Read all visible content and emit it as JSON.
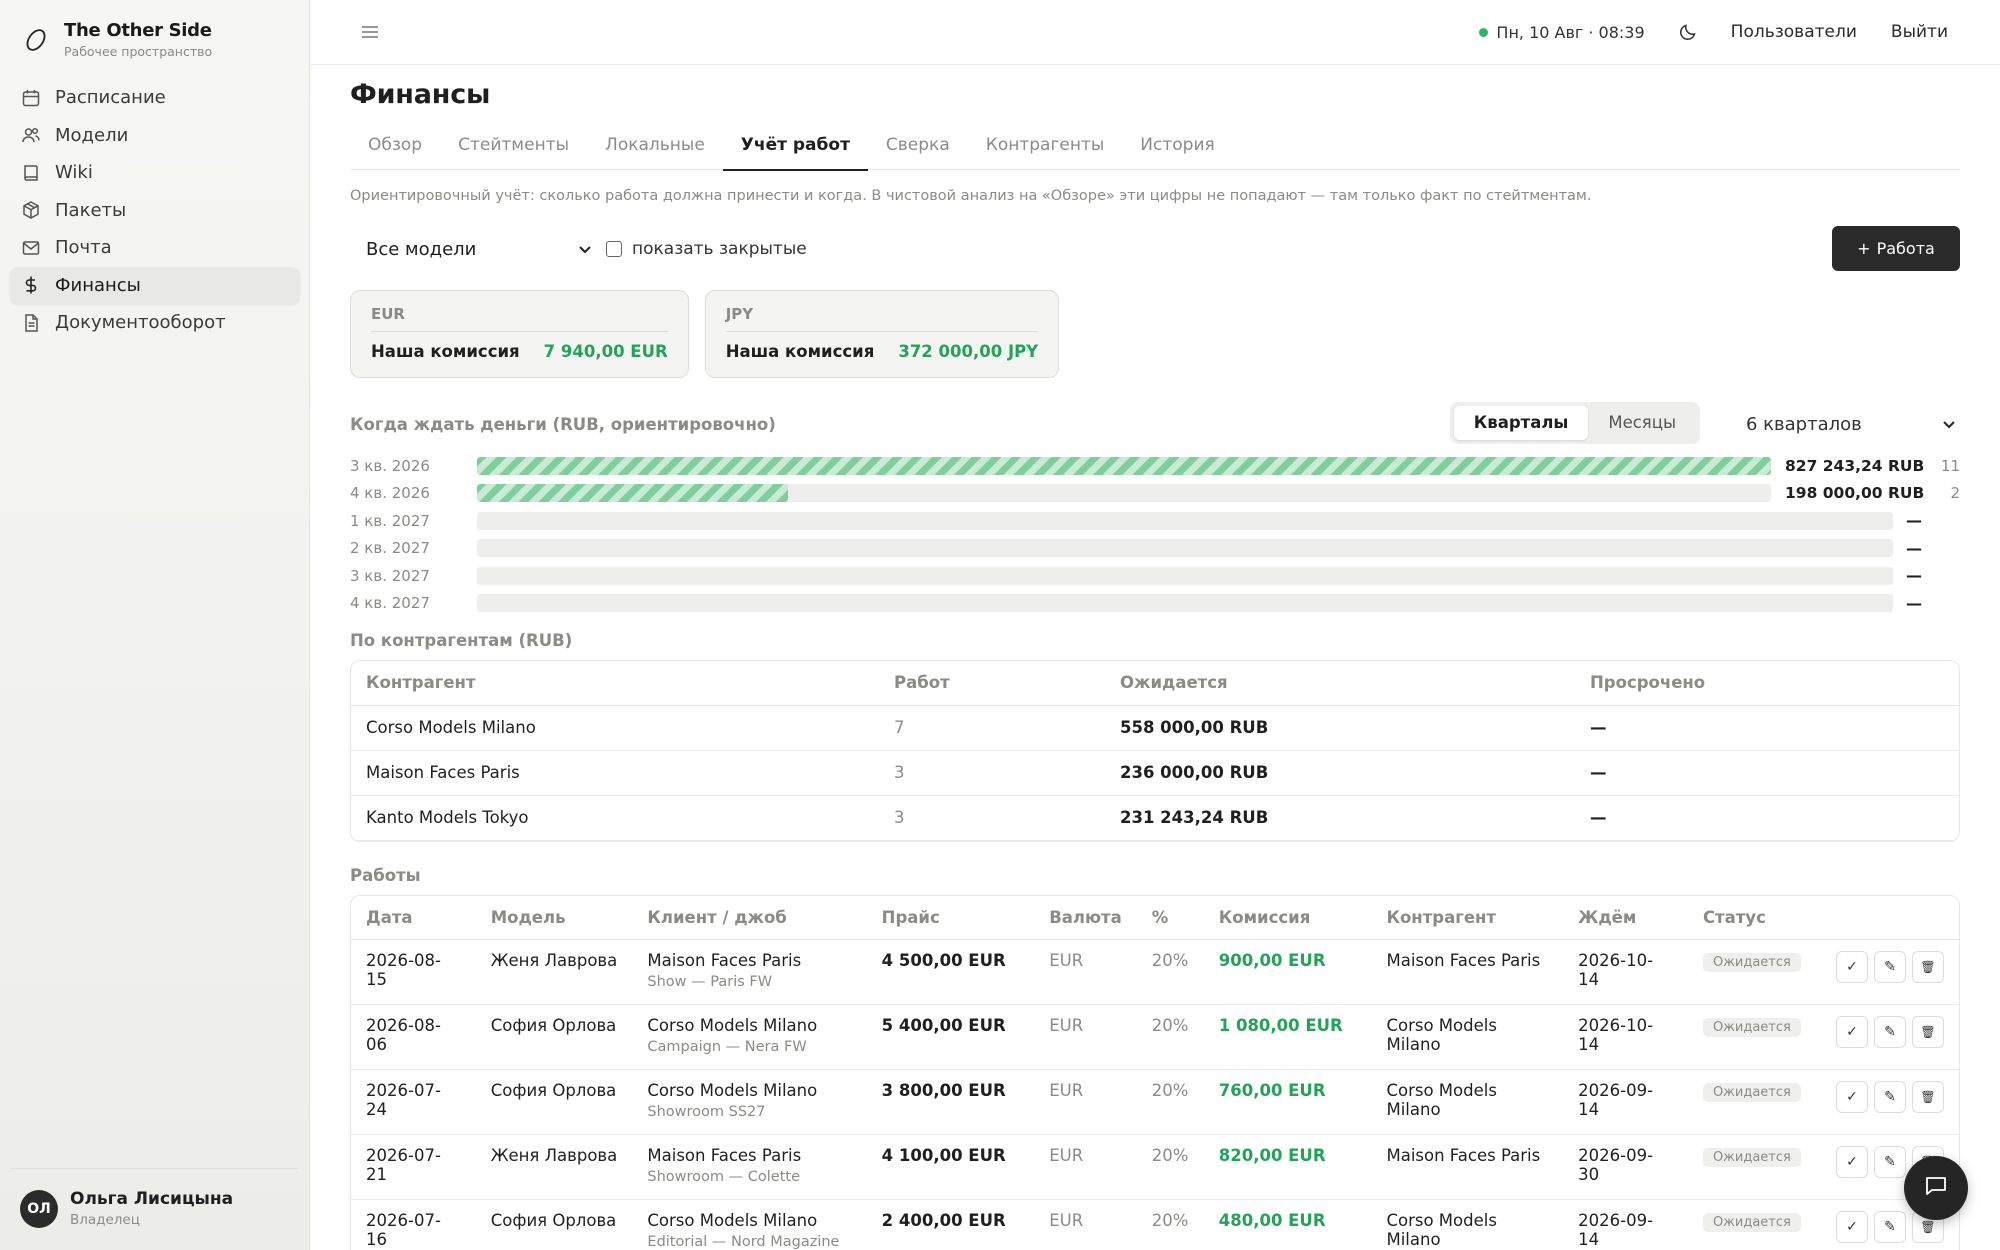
{
  "app": {
    "title": "The Other Side",
    "subtitle": "Рабочее пространство"
  },
  "sidebar": {
    "items": [
      {
        "label": "Расписание",
        "icon": "calendar-icon"
      },
      {
        "label": "Модели",
        "icon": "users-icon"
      },
      {
        "label": "Wiki",
        "icon": "book-icon"
      },
      {
        "label": "Пакеты",
        "icon": "package-icon"
      },
      {
        "label": "Почта",
        "icon": "mail-icon"
      },
      {
        "label": "Финансы",
        "icon": "dollar-icon",
        "active": true
      },
      {
        "label": "Документооборот",
        "icon": "document-icon"
      }
    ],
    "user": {
      "initials": "ОЛ",
      "name": "Ольга Лисицына",
      "role": "Владелец"
    }
  },
  "topbar": {
    "datetime": "Пн, 10 Авг · 08:39",
    "users_label": "Пользователи",
    "logout_label": "Выйти"
  },
  "page": {
    "title": "Финансы",
    "tabs": [
      "Обзор",
      "Стейтменты",
      "Локальные",
      "Учёт работ",
      "Сверка",
      "Контрагенты",
      "История"
    ],
    "active_tab": "Учёт работ",
    "hint": "Ориентировочный учёт: сколько работа должна принести и когда. В чистовой анализ на «Обзоре» эти цифры не попадают — там только факт по стейтментам."
  },
  "filters": {
    "model_select": "Все модели",
    "show_closed_label": "показать закрытые",
    "add_button": "Работа"
  },
  "commission_cards": [
    {
      "currency": "EUR",
      "label": "Наша комиссия",
      "value": "7 940,00 EUR"
    },
    {
      "currency": "JPY",
      "label": "Наша комиссия",
      "value": "372 000,00 JPY"
    }
  ],
  "timeline": {
    "title": "Когда ждать деньги (RUB, ориентировочно)",
    "toggle": [
      "Кварталы",
      "Месяцы"
    ],
    "active_toggle": "Кварталы",
    "period_select": "6 кварталов",
    "rows": [
      {
        "label": "3 кв. 2026",
        "fill": 1.0,
        "amount": "827 243,24 RUB",
        "count": "11"
      },
      {
        "label": "4 кв. 2026",
        "fill": 0.24,
        "amount": "198 000,00 RUB",
        "count": "2"
      },
      {
        "label": "1 кв. 2027",
        "fill": 0,
        "amount": "—",
        "count": ""
      },
      {
        "label": "2 кв. 2027",
        "fill": 0,
        "amount": "—",
        "count": ""
      },
      {
        "label": "3 кв. 2027",
        "fill": 0,
        "amount": "—",
        "count": ""
      },
      {
        "label": "4 кв. 2027",
        "fill": 0,
        "amount": "—",
        "count": ""
      }
    ]
  },
  "counterparties": {
    "title": "По контрагентам (RUB)",
    "columns": [
      "Контрагент",
      "Работ",
      "Ожидается",
      "Просрочено"
    ],
    "rows": [
      {
        "name": "Corso Models Milano",
        "count": "7",
        "expected": "558 000,00 RUB",
        "overdue": "—"
      },
      {
        "name": "Maison Faces Paris",
        "count": "3",
        "expected": "236 000,00 RUB",
        "overdue": "—"
      },
      {
        "name": "Kanto Models Tokyo",
        "count": "3",
        "expected": "231 243,24 RUB",
        "overdue": "—"
      }
    ]
  },
  "works": {
    "title": "Работы",
    "columns": [
      "Дата",
      "Модель",
      "Клиент / джоб",
      "Прайс",
      "Валюта",
      "%",
      "Комиссия",
      "Контрагент",
      "Ждём",
      "Статус"
    ],
    "rows": [
      {
        "date": "2026-08-15",
        "model": "Женя Лаврова",
        "client": "Maison Faces Paris",
        "job": "Show — Paris FW",
        "price": "4 500,00 EUR",
        "currency": "EUR",
        "pct": "20%",
        "commission": "900,00 EUR",
        "counterparty": "Maison Faces Paris",
        "due": "2026-10-14",
        "status": "Ожидается"
      },
      {
        "date": "2026-08-06",
        "model": "София Орлова",
        "client": "Corso Models Milano",
        "job": "Campaign — Nera FW",
        "price": "5 400,00 EUR",
        "currency": "EUR",
        "pct": "20%",
        "commission": "1 080,00 EUR",
        "counterparty": "Corso Models Milano",
        "due": "2026-10-14",
        "status": "Ожидается"
      },
      {
        "date": "2026-07-24",
        "model": "София Орлова",
        "client": "Corso Models Milano",
        "job": "Showroom SS27",
        "price": "3 800,00 EUR",
        "currency": "EUR",
        "pct": "20%",
        "commission": "760,00 EUR",
        "counterparty": "Corso Models Milano",
        "due": "2026-09-14",
        "status": "Ожидается"
      },
      {
        "date": "2026-07-21",
        "model": "Женя Лаврова",
        "client": "Maison Faces Paris",
        "job": "Showroom — Colette",
        "price": "4 100,00 EUR",
        "currency": "EUR",
        "pct": "20%",
        "commission": "820,00 EUR",
        "counterparty": "Maison Faces Paris",
        "due": "2026-09-30",
        "status": "Ожидается"
      },
      {
        "date": "2026-07-16",
        "model": "София Орлова",
        "client": "Corso Models Milano",
        "job": "Editorial — Nord Magazine",
        "price": "2 400,00 EUR",
        "currency": "EUR",
        "pct": "20%",
        "commission": "480,00 EUR",
        "counterparty": "Corso Models Milano",
        "due": "2026-09-14",
        "status": "Ожидается"
      }
    ]
  },
  "colors": {
    "accent_green": "#23a35a",
    "dark_button": "#2a2a2a",
    "status_dot": "#2eb561"
  }
}
